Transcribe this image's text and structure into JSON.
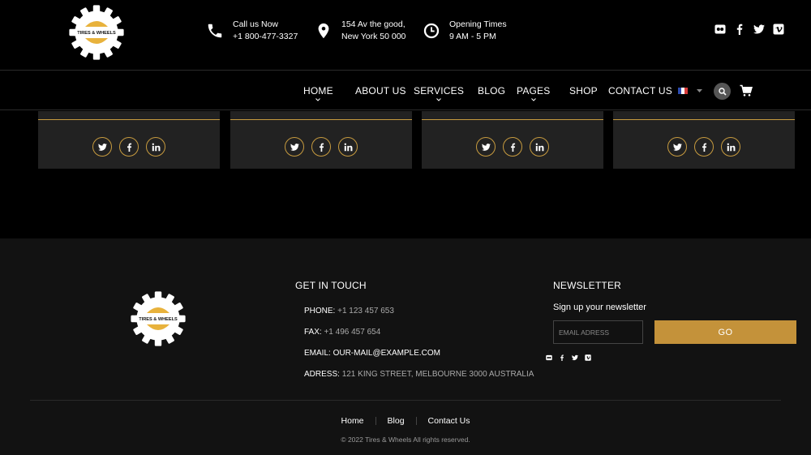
{
  "brand": {
    "logo_text": "TIRES & WHEELS",
    "icon": "tires-wheels-logo",
    "accent": "#c79b3f"
  },
  "header": {
    "call": {
      "icon": "phone-icon",
      "line1": "Call us Now",
      "line2": "+1 800-477-3327"
    },
    "address": {
      "icon": "map-pin-icon",
      "line1": "154 Av the good,",
      "line2": "New York 50 000"
    },
    "hours": {
      "icon": "clock-icon",
      "line1": "Opening Times",
      "line2": "9 AM - 5 PM"
    },
    "social": [
      "flickr-icon",
      "facebook-icon",
      "twitter-icon",
      "vimeo-icon"
    ]
  },
  "nav": {
    "items": [
      {
        "label": "HOME",
        "has_dropdown": true
      },
      {
        "label": "ABOUT US",
        "has_dropdown": false
      },
      {
        "label": "SERVICES",
        "has_dropdown": true
      },
      {
        "label": "BLOG",
        "has_dropdown": false
      },
      {
        "label": "PAGES",
        "has_dropdown": true
      },
      {
        "label": "SHOP",
        "has_dropdown": false
      },
      {
        "label": "CONTACT US",
        "has_dropdown": false
      }
    ],
    "language": "french-flag-icon",
    "search_icon": "search-icon",
    "cart_icon": "cart-icon"
  },
  "team_cards": {
    "count": 4,
    "social": [
      "twitter-icon",
      "facebook-icon",
      "linkedin-icon"
    ]
  },
  "footer": {
    "contact": {
      "heading": "GET IN TOUCH",
      "phone_label": "PHONE:",
      "phone": "+1 123 457 653",
      "fax_label": "FAX:",
      "fax": "+1 496 457 654",
      "email_label": "EMAIL:",
      "email": "OUR-MAIL@EXAMPLE.COM",
      "address_label": "ADRESS:",
      "address": "121 KING STREET, MELBOURNE 3000 AUSTRALIA"
    },
    "newsletter": {
      "heading": "NEWSLETTER",
      "subtitle": "Sign up your newsletter",
      "placeholder": "EMAIL ADRESS",
      "button": "GO",
      "social": [
        "flickr-icon",
        "facebook-icon",
        "twitter-icon",
        "vimeo-icon"
      ]
    },
    "links": [
      "Home",
      "Blog",
      "Contact Us"
    ],
    "copyright": "© 2022 Tires & Wheels All rights reserved."
  }
}
